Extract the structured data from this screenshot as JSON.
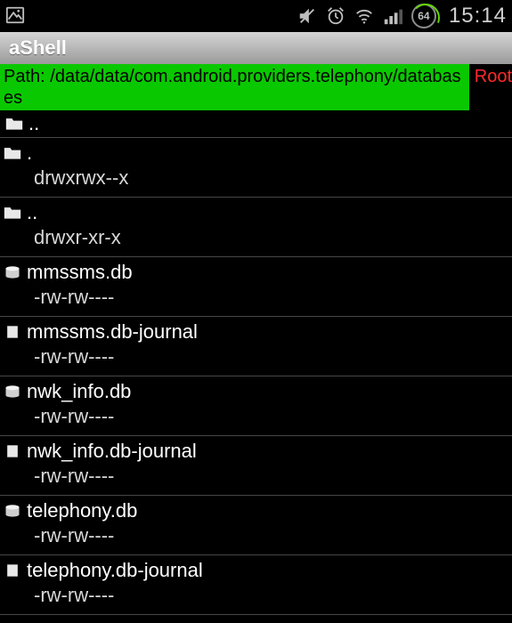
{
  "status_bar": {
    "battery_pct": "64",
    "clock": "15:14"
  },
  "title_bar": {
    "app_name": "aShell"
  },
  "path_bar": {
    "prefix": "Path: ",
    "path": "/data/data/com.android.providers.telephony/databases",
    "root_label": "Root"
  },
  "entries": [
    {
      "icon": "folder",
      "name": "..",
      "perm": ""
    },
    {
      "icon": "folder",
      "name": ".",
      "perm": "drwxrwx--x"
    },
    {
      "icon": "folder",
      "name": "..",
      "perm": "drwxr-xr-x"
    },
    {
      "icon": "db",
      "name": "mmssms.db",
      "perm": "-rw-rw----"
    },
    {
      "icon": "file",
      "name": "mmssms.db-journal",
      "perm": "-rw-rw----"
    },
    {
      "icon": "db",
      "name": "nwk_info.db",
      "perm": "-rw-rw----"
    },
    {
      "icon": "file",
      "name": "nwk_info.db-journal",
      "perm": "-rw-rw----"
    },
    {
      "icon": "db",
      "name": "telephony.db",
      "perm": "-rw-rw----"
    },
    {
      "icon": "file",
      "name": "telephony.db-journal",
      "perm": "-rw-rw----"
    }
  ]
}
